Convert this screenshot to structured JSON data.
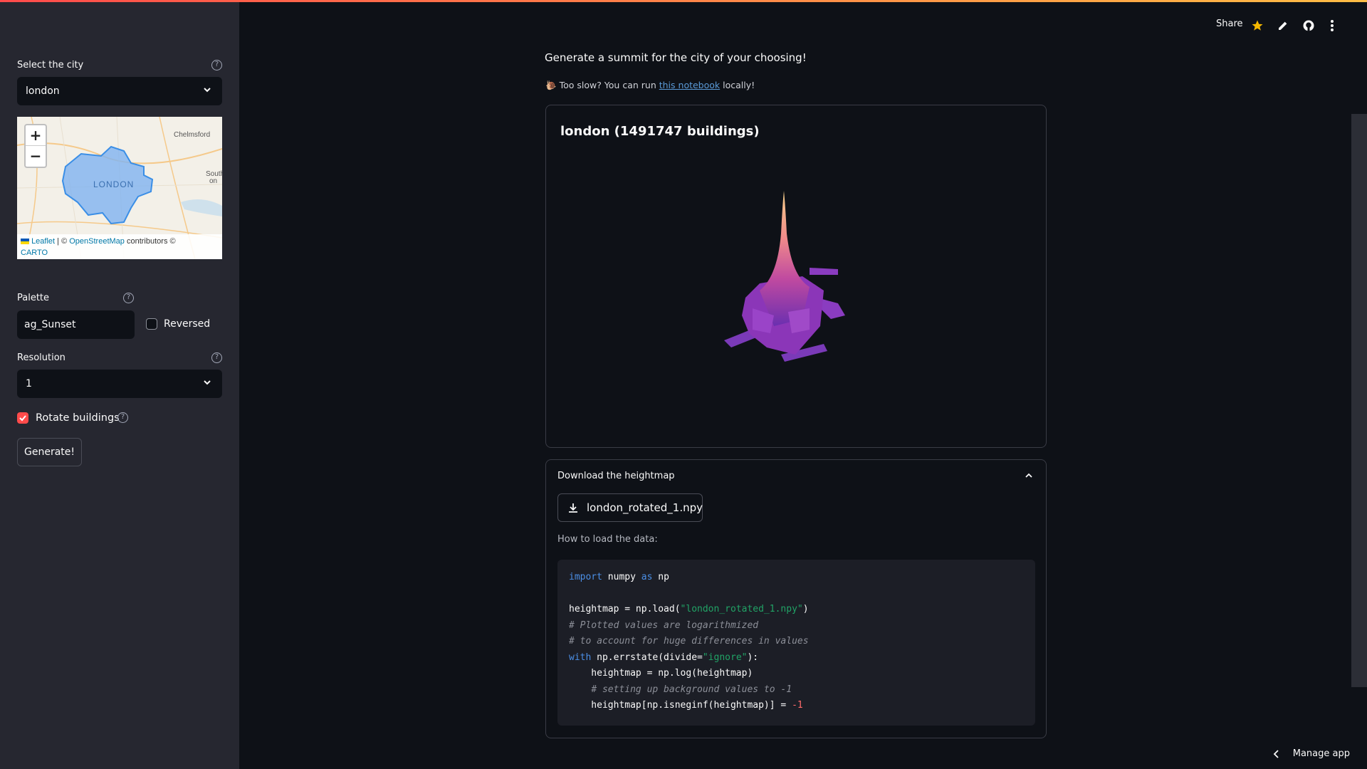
{
  "sidebar": {
    "city_label": "Select the city",
    "city_value": "london",
    "map": {
      "zoom_in": "+",
      "zoom_out": "−",
      "labels": {
        "london": "LONDON",
        "chelmsford": "Chelmsford",
        "south": "South",
        "on": "on"
      },
      "attribution": {
        "leaflet": "Leaflet",
        "sep": "| ©",
        "osm": "OpenStreetMap",
        "contrib": "contributors ©",
        "carto": "CARTO"
      }
    },
    "palette_label": "Palette",
    "palette_value": "ag_Sunset",
    "reversed_label": "Reversed",
    "reversed_checked": false,
    "resolution_label": "Resolution",
    "resolution_value": "1",
    "rotate_label": "Rotate buildings",
    "rotate_checked": true,
    "generate_label": "Generate!"
  },
  "topnav": {
    "share": "Share",
    "star_icon": "star-icon",
    "edit_icon": "pencil-icon",
    "github_icon": "github-icon",
    "menu_icon": "kebab-menu-icon"
  },
  "main": {
    "intro": "Generate a summit for the city of your choosing!",
    "slow_prefix": "Too slow? You can run",
    "slow_link": "this notebook",
    "slow_suffix": "locally!",
    "plot_title": "london (1491747 buildings)",
    "expander": {
      "header": "Download the heightmap",
      "download_label": "london_rotated_1.npy",
      "howto": "How to load the data:"
    }
  },
  "footer": {
    "manage_app": "Manage app"
  },
  "colors": {
    "accent": "#ff4b4b",
    "bg": "#0e1117",
    "sidebar": "#262730"
  }
}
